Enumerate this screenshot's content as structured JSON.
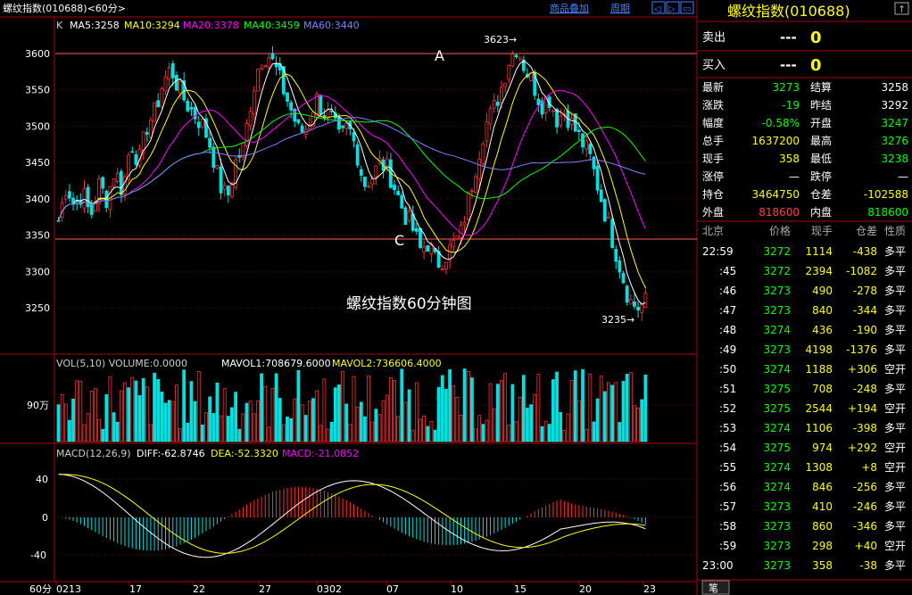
{
  "window": {
    "title": "螺纹指数(010688)<60分>",
    "menu_items": [
      "商品叠加",
      "周期"
    ],
    "nav_arrows": [
      "◁",
      "▷",
      "▭"
    ]
  },
  "main_chart": {
    "ma_label_prefix": "K",
    "ma_labels": [
      {
        "text": "MA5:3258",
        "color": "#ffffff"
      },
      {
        "text": "MA10:3294",
        "color": "#ffff00"
      },
      {
        "text": "MA20:3378",
        "color": "#ff00ff"
      },
      {
        "text": "MA40:3459",
        "color": "#00ff00"
      },
      {
        "text": "MA60:3440",
        "color": "#8080ff"
      }
    ],
    "annotations": {
      "label_a": "A",
      "label_c": "C",
      "high_label": "3623→",
      "low_label": "3235→",
      "center_text": "螺纹指数60分钟图"
    },
    "price_ticks": [
      "3600",
      "3550",
      "3500",
      "3450",
      "3400",
      "3350",
      "3300",
      "3250"
    ]
  },
  "volume_panel": {
    "header": "VOL(5,10) VOLUME:0.0000",
    "mavol1": "MAVOL1:708679.6000",
    "mavol2": "MAVOL2:736606.4000",
    "tick": "90万"
  },
  "macd_panel": {
    "header": "MACD(12,26,9)",
    "diff": "DIFF:-62.8746",
    "dea": "DEA:-52.3320",
    "macd": "MACD:-21.0852",
    "ticks": [
      "40",
      "0",
      "-40"
    ]
  },
  "x_axis": {
    "period_label": "60分",
    "labels": [
      "0213",
      "17",
      "22",
      "27",
      "0302",
      "07",
      "10",
      "15",
      "20",
      "23"
    ]
  },
  "chart_data": {
    "type": "candlestick",
    "title": "螺纹指数(010688)",
    "period": "60分",
    "ylim": [
      3200,
      3640
    ],
    "high": 3623,
    "low": 3235,
    "ma_values": {
      "MA5": 3258,
      "MA10": 3294,
      "MA20": 3378,
      "MA40": 3459,
      "MA60": 3440
    },
    "close_path": [
      3370,
      3420,
      3390,
      3410,
      3375,
      3420,
      3400,
      3440,
      3410,
      3480,
      3450,
      3500,
      3520,
      3560,
      3580,
      3550,
      3530,
      3515,
      3500,
      3470,
      3420,
      3400,
      3450,
      3470,
      3540,
      3590,
      3600,
      3580,
      3550,
      3520,
      3490,
      3500,
      3540,
      3520,
      3510,
      3480,
      3500,
      3470,
      3420,
      3430,
      3450,
      3440,
      3410,
      3380,
      3360,
      3330,
      3340,
      3310,
      3320,
      3335,
      3350,
      3400,
      3450,
      3500,
      3520,
      3550,
      3590,
      3610,
      3580,
      3560,
      3530,
      3540,
      3510,
      3520,
      3500,
      3480,
      3460,
      3420,
      3380,
      3340,
      3300,
      3260,
      3250,
      3258
    ]
  },
  "quote_panel": {
    "title": "螺纹指数(010688)",
    "sell_label": "卖出",
    "sell_price": "---",
    "sell_vol": "0",
    "buy_label": "买入",
    "buy_price": "---",
    "buy_vol": "0",
    "stats": [
      {
        "l1": "最新",
        "v1": "3273",
        "c1": "#00ff00",
        "l2": "结算",
        "v2": "3258",
        "c2": "#ffffff"
      },
      {
        "l1": "涨跌",
        "v1": "-19",
        "c1": "#00ff00",
        "l2": "昨结",
        "v2": "3292",
        "c2": "#ffffff"
      },
      {
        "l1": "幅度",
        "v1": "-0.58%",
        "c1": "#00ff00",
        "l2": "开盘",
        "v2": "3247",
        "c2": "#00ff00"
      },
      {
        "l1": "总手",
        "v1": "1637200",
        "c1": "#ffff00",
        "l2": "最高",
        "v2": "3276",
        "c2": "#00ff00"
      },
      {
        "l1": "现手",
        "v1": "358",
        "c1": "#ffff00",
        "l2": "最低",
        "v2": "3238",
        "c2": "#00ff00"
      },
      {
        "l1": "涨停",
        "v1": "—",
        "c1": "#ffffff",
        "l2": "跌停",
        "v2": "—",
        "c2": "#ffffff"
      },
      {
        "l1": "持仓",
        "v1": "3464750",
        "c1": "#ffff00",
        "l2": "仓差",
        "v2": "-102588",
        "c2": "#ffff00"
      },
      {
        "l1": "外盘",
        "v1": "818600",
        "c1": "#ff4040",
        "l2": "内盘",
        "v2": "818600",
        "c2": "#00ff00"
      }
    ],
    "tick_headers": [
      "北京",
      "价格",
      "现手",
      "仓差",
      "性质"
    ],
    "ticks": [
      {
        "time": "22:59",
        "price": "3272",
        "vol": "1114",
        "diff": "-438",
        "nature": "多平"
      },
      {
        "time": ":45",
        "price": "3272",
        "vol": "2394",
        "diff": "-1082",
        "nature": "多平"
      },
      {
        "time": ":46",
        "price": "3273",
        "vol": "490",
        "diff": "-278",
        "nature": "多平"
      },
      {
        "time": ":47",
        "price": "3273",
        "vol": "840",
        "diff": "-344",
        "nature": "多平"
      },
      {
        "time": ":48",
        "price": "3274",
        "vol": "436",
        "diff": "-190",
        "nature": "多平"
      },
      {
        "time": ":49",
        "price": "3273",
        "vol": "4198",
        "diff": "-1376",
        "nature": "多平"
      },
      {
        "time": ":50",
        "price": "3274",
        "vol": "1188",
        "diff": "+306",
        "nature": "空开"
      },
      {
        "time": ":51",
        "price": "3275",
        "vol": "708",
        "diff": "-248",
        "nature": "多平"
      },
      {
        "time": ":52",
        "price": "3275",
        "vol": "2544",
        "diff": "+194",
        "nature": "空开"
      },
      {
        "time": ":53",
        "price": "3274",
        "vol": "1106",
        "diff": "-398",
        "nature": "多平"
      },
      {
        "time": ":54",
        "price": "3275",
        "vol": "974",
        "diff": "+292",
        "nature": "空开"
      },
      {
        "time": ":55",
        "price": "3274",
        "vol": "1308",
        "diff": "+8",
        "nature": "空开"
      },
      {
        "time": ":56",
        "price": "3274",
        "vol": "846",
        "diff": "-256",
        "nature": "多平"
      },
      {
        "time": ":57",
        "price": "3273",
        "vol": "410",
        "diff": "-246",
        "nature": "多平"
      },
      {
        "time": ":58",
        "price": "3273",
        "vol": "860",
        "diff": "-346",
        "nature": "多平"
      },
      {
        "time": ":59",
        "price": "3273",
        "vol": "298",
        "diff": "+40",
        "nature": "空开"
      },
      {
        "time": "23:00",
        "price": "3273",
        "vol": "358",
        "diff": "-38",
        "nature": "多平"
      }
    ],
    "bottom_tab": "笔"
  }
}
